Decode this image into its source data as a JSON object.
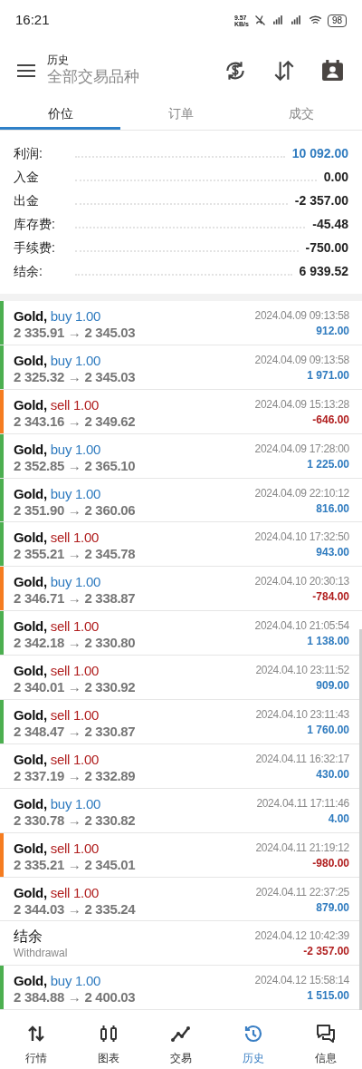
{
  "status_bar": {
    "time": "16:21",
    "speed": "9.57 KB/s",
    "battery": "98"
  },
  "header": {
    "title": "历史",
    "subtitle": "全部交易品种"
  },
  "tabs": [
    {
      "label": "价位",
      "selected": true
    },
    {
      "label": "订单",
      "selected": false
    },
    {
      "label": "成交",
      "selected": false
    }
  ],
  "summary": [
    {
      "label": "利润:",
      "value": "10 092.00",
      "highlight": true
    },
    {
      "label": "入金",
      "value": "0.00",
      "highlight": false
    },
    {
      "label": "出金",
      "value": "-2 357.00",
      "highlight": false
    },
    {
      "label": "库存费:",
      "value": "-45.48",
      "highlight": false
    },
    {
      "label": "手续费:",
      "value": "-750.00",
      "highlight": false
    },
    {
      "label": "结余:",
      "value": "6 939.52",
      "highlight": false
    }
  ],
  "deals": [
    {
      "kind": "trade",
      "symbol": "Gold,",
      "sell": false,
      "volume": "buy 1.00",
      "prices": "2 335.91 → 2 345.03",
      "time": "2024.04.09 09:13:58",
      "profit": "912.00",
      "negative": false,
      "color": "#4caf50"
    },
    {
      "kind": "trade",
      "symbol": "Gold,",
      "sell": false,
      "volume": "buy 1.00",
      "prices": "2 325.32 → 2 345.03",
      "time": "2024.04.09 09:13:58",
      "profit": "1 971.00",
      "negative": false,
      "color": "#4caf50"
    },
    {
      "kind": "trade",
      "symbol": "Gold,",
      "sell": true,
      "volume": "sell 1.00",
      "prices": "2 343.16 → 2 349.62",
      "time": "2024.04.09 15:13:28",
      "profit": "-646.00",
      "negative": true,
      "color": "#f57c20"
    },
    {
      "kind": "trade",
      "symbol": "Gold,",
      "sell": false,
      "volume": "buy 1.00",
      "prices": "2 352.85 → 2 365.10",
      "time": "2024.04.09 17:28:00",
      "profit": "1 225.00",
      "negative": false,
      "color": "#4caf50"
    },
    {
      "kind": "trade",
      "symbol": "Gold,",
      "sell": false,
      "volume": "buy 1.00",
      "prices": "2 351.90 → 2 360.06",
      "time": "2024.04.09 22:10:12",
      "profit": "816.00",
      "negative": false,
      "color": "#4caf50"
    },
    {
      "kind": "trade",
      "symbol": "Gold,",
      "sell": true,
      "volume": "sell 1.00",
      "prices": "2 355.21 → 2 345.78",
      "time": "2024.04.10 17:32:50",
      "profit": "943.00",
      "negative": false,
      "color": "#4caf50"
    },
    {
      "kind": "trade",
      "symbol": "Gold,",
      "sell": false,
      "volume": "buy 1.00",
      "prices": "2 346.71 → 2 338.87",
      "time": "2024.04.10 20:30:13",
      "profit": "-784.00",
      "negative": true,
      "color": "#f57c20"
    },
    {
      "kind": "trade",
      "symbol": "Gold,",
      "sell": true,
      "volume": "sell 1.00",
      "prices": "2 342.18 → 2 330.80",
      "time": "2024.04.10 21:05:54",
      "profit": "1 138.00",
      "negative": false,
      "color": "#4caf50"
    },
    {
      "kind": "trade",
      "symbol": "Gold,",
      "sell": true,
      "volume": "sell 1.00",
      "prices": "2 340.01 → 2 330.92",
      "time": "2024.04.10 23:11:52",
      "profit": "909.00",
      "negative": false
    },
    {
      "kind": "trade",
      "symbol": "Gold,",
      "sell": true,
      "volume": "sell 1.00",
      "prices": "2 348.47 → 2 330.87",
      "time": "2024.04.10 23:11:43",
      "profit": "1 760.00",
      "negative": false,
      "color": "#4caf50"
    },
    {
      "kind": "trade",
      "symbol": "Gold,",
      "sell": true,
      "volume": "sell 1.00",
      "prices": "2 337.19 → 2 332.89",
      "time": "2024.04.11 16:32:17",
      "profit": "430.00",
      "negative": false
    },
    {
      "kind": "trade",
      "symbol": "Gold,",
      "sell": false,
      "volume": "buy 1.00",
      "prices": "2 330.78 → 2 330.82",
      "time": "2024.04.11 17:11:46",
      "profit": "4.00",
      "negative": false
    },
    {
      "kind": "trade",
      "symbol": "Gold,",
      "sell": true,
      "volume": "sell 1.00",
      "prices": "2 335.21 → 2 345.01",
      "time": "2024.04.11 21:19:12",
      "profit": "-980.00",
      "negative": true,
      "color": "#f57c20"
    },
    {
      "kind": "trade",
      "symbol": "Gold,",
      "sell": true,
      "volume": "sell 1.00",
      "prices": "2 344.03 → 2 335.24",
      "time": "2024.04.11 22:37:25",
      "profit": "879.00",
      "negative": false
    },
    {
      "kind": "balance",
      "title": "结余",
      "comment": "Withdrawal",
      "time": "2024.04.12 10:42:39",
      "profit": "-2 357.00",
      "negative": true
    },
    {
      "kind": "trade",
      "symbol": "Gold,",
      "sell": false,
      "volume": "buy 1.00",
      "prices": "2 384.88 → 2 400.03",
      "time": "2024.04.12 15:58:14",
      "profit": "1 515.00",
      "negative": false,
      "color": "#4caf50"
    }
  ],
  "bottom_nav": [
    {
      "label": "行情",
      "selected": false
    },
    {
      "label": "图表",
      "selected": false
    },
    {
      "label": "交易",
      "selected": false
    },
    {
      "label": "历史",
      "selected": true
    },
    {
      "label": "信息",
      "selected": false
    }
  ]
}
